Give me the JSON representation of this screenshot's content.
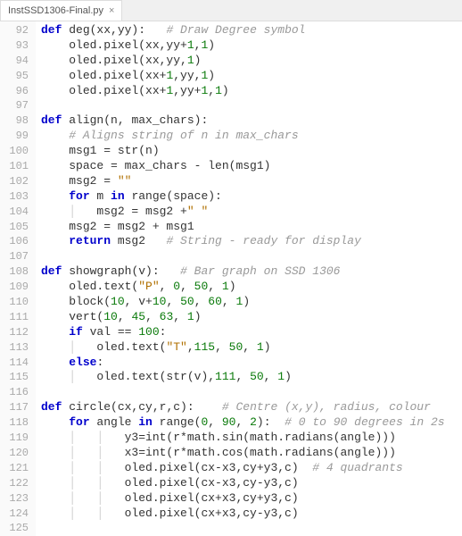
{
  "tab": {
    "filename": "InstSSD1306-Final.py"
  },
  "gutter": {
    "start": 92,
    "end": 125
  },
  "code": {
    "lines": [
      {
        "i": "",
        "t": [
          {
            "k": "kw",
            "s": "def"
          },
          {
            "k": "",
            "s": " "
          },
          {
            "k": "fn",
            "s": "deg"
          },
          {
            "k": "",
            "s": "(xx,yy):   "
          },
          {
            "k": "cmt",
            "s": "# Draw Degree symbol"
          }
        ]
      },
      {
        "i": "    ",
        "t": [
          {
            "k": "",
            "s": "oled.pixel(xx,yy+"
          },
          {
            "k": "num",
            "s": "1"
          },
          {
            "k": "",
            "s": ","
          },
          {
            "k": "num",
            "s": "1"
          },
          {
            "k": "",
            "s": ")"
          }
        ]
      },
      {
        "i": "    ",
        "t": [
          {
            "k": "",
            "s": "oled.pixel(xx,yy,"
          },
          {
            "k": "num",
            "s": "1"
          },
          {
            "k": "",
            "s": ")"
          }
        ]
      },
      {
        "i": "    ",
        "t": [
          {
            "k": "",
            "s": "oled.pixel(xx+"
          },
          {
            "k": "num",
            "s": "1"
          },
          {
            "k": "",
            "s": ",yy,"
          },
          {
            "k": "num",
            "s": "1"
          },
          {
            "k": "",
            "s": ")"
          }
        ]
      },
      {
        "i": "    ",
        "t": [
          {
            "k": "",
            "s": "oled.pixel(xx+"
          },
          {
            "k": "num",
            "s": "1"
          },
          {
            "k": "",
            "s": ",yy+"
          },
          {
            "k": "num",
            "s": "1"
          },
          {
            "k": "",
            "s": ","
          },
          {
            "k": "num",
            "s": "1"
          },
          {
            "k": "",
            "s": ")"
          }
        ]
      },
      {
        "i": "",
        "t": []
      },
      {
        "i": "",
        "t": [
          {
            "k": "kw",
            "s": "def"
          },
          {
            "k": "",
            "s": " "
          },
          {
            "k": "fn",
            "s": "align"
          },
          {
            "k": "",
            "s": "(n, max_chars):"
          }
        ]
      },
      {
        "i": "    ",
        "t": [
          {
            "k": "cmt",
            "s": "# Aligns string of n in max_chars"
          }
        ]
      },
      {
        "i": "    ",
        "t": [
          {
            "k": "",
            "s": "msg1 = str(n)"
          }
        ]
      },
      {
        "i": "    ",
        "t": [
          {
            "k": "",
            "s": "space = max_chars - len(msg1)"
          }
        ]
      },
      {
        "i": "    ",
        "t": [
          {
            "k": "",
            "s": "msg2 = "
          },
          {
            "k": "str",
            "s": "\"\""
          }
        ]
      },
      {
        "i": "    ",
        "t": [
          {
            "k": "kw",
            "s": "for"
          },
          {
            "k": "",
            "s": " m "
          },
          {
            "k": "kw",
            "s": "in"
          },
          {
            "k": "",
            "s": " range(space):"
          }
        ]
      },
      {
        "i": "    |   ",
        "t": [
          {
            "k": "",
            "s": "msg2 = msg2 +"
          },
          {
            "k": "str",
            "s": "\" \""
          }
        ]
      },
      {
        "i": "    ",
        "t": [
          {
            "k": "",
            "s": "msg2 = msg2 + msg1"
          }
        ]
      },
      {
        "i": "    ",
        "t": [
          {
            "k": "kw",
            "s": "return"
          },
          {
            "k": "",
            "s": " msg2   "
          },
          {
            "k": "cmt",
            "s": "# String - ready for display"
          }
        ]
      },
      {
        "i": "",
        "t": []
      },
      {
        "i": "",
        "t": [
          {
            "k": "kw",
            "s": "def"
          },
          {
            "k": "",
            "s": " "
          },
          {
            "k": "fn",
            "s": "showgraph"
          },
          {
            "k": "",
            "s": "(v):   "
          },
          {
            "k": "cmt",
            "s": "# Bar graph on SSD 1306"
          }
        ]
      },
      {
        "i": "    ",
        "t": [
          {
            "k": "",
            "s": "oled.text("
          },
          {
            "k": "str",
            "s": "\"P\""
          },
          {
            "k": "",
            "s": ", "
          },
          {
            "k": "num",
            "s": "0"
          },
          {
            "k": "",
            "s": ", "
          },
          {
            "k": "num",
            "s": "50"
          },
          {
            "k": "",
            "s": ", "
          },
          {
            "k": "num",
            "s": "1"
          },
          {
            "k": "",
            "s": ")"
          }
        ]
      },
      {
        "i": "    ",
        "t": [
          {
            "k": "",
            "s": "block("
          },
          {
            "k": "num",
            "s": "10"
          },
          {
            "k": "",
            "s": ", v+"
          },
          {
            "k": "num",
            "s": "10"
          },
          {
            "k": "",
            "s": ", "
          },
          {
            "k": "num",
            "s": "50"
          },
          {
            "k": "",
            "s": ", "
          },
          {
            "k": "num",
            "s": "60"
          },
          {
            "k": "",
            "s": ", "
          },
          {
            "k": "num",
            "s": "1"
          },
          {
            "k": "",
            "s": ")"
          }
        ]
      },
      {
        "i": "    ",
        "t": [
          {
            "k": "",
            "s": "vert("
          },
          {
            "k": "num",
            "s": "10"
          },
          {
            "k": "",
            "s": ", "
          },
          {
            "k": "num",
            "s": "45"
          },
          {
            "k": "",
            "s": ", "
          },
          {
            "k": "num",
            "s": "63"
          },
          {
            "k": "",
            "s": ", "
          },
          {
            "k": "num",
            "s": "1"
          },
          {
            "k": "",
            "s": ")"
          }
        ]
      },
      {
        "i": "    ",
        "t": [
          {
            "k": "kw",
            "s": "if"
          },
          {
            "k": "",
            "s": " val == "
          },
          {
            "k": "num",
            "s": "100"
          },
          {
            "k": "",
            "s": ":"
          }
        ]
      },
      {
        "i": "    |   ",
        "t": [
          {
            "k": "",
            "s": "oled.text("
          },
          {
            "k": "str",
            "s": "\"T\""
          },
          {
            "k": "",
            "s": ","
          },
          {
            "k": "num",
            "s": "115"
          },
          {
            "k": "",
            "s": ", "
          },
          {
            "k": "num",
            "s": "50"
          },
          {
            "k": "",
            "s": ", "
          },
          {
            "k": "num",
            "s": "1"
          },
          {
            "k": "",
            "s": ")"
          }
        ]
      },
      {
        "i": "    ",
        "t": [
          {
            "k": "kw",
            "s": "else"
          },
          {
            "k": "",
            "s": ":"
          }
        ]
      },
      {
        "i": "    |   ",
        "t": [
          {
            "k": "",
            "s": "oled.text(str(v),"
          },
          {
            "k": "num",
            "s": "111"
          },
          {
            "k": "",
            "s": ", "
          },
          {
            "k": "num",
            "s": "50"
          },
          {
            "k": "",
            "s": ", "
          },
          {
            "k": "num",
            "s": "1"
          },
          {
            "k": "",
            "s": ")"
          }
        ]
      },
      {
        "i": "",
        "t": []
      },
      {
        "i": "",
        "t": [
          {
            "k": "kw",
            "s": "def"
          },
          {
            "k": "",
            "s": " "
          },
          {
            "k": "fn",
            "s": "circle"
          },
          {
            "k": "",
            "s": "(cx,cy,r,c):    "
          },
          {
            "k": "cmt",
            "s": "# Centre (x,y), radius, colour"
          }
        ]
      },
      {
        "i": "    ",
        "t": [
          {
            "k": "kw",
            "s": "for"
          },
          {
            "k": "",
            "s": " angle "
          },
          {
            "k": "kw",
            "s": "in"
          },
          {
            "k": "",
            "s": " range("
          },
          {
            "k": "num",
            "s": "0"
          },
          {
            "k": "",
            "s": ", "
          },
          {
            "k": "num",
            "s": "90"
          },
          {
            "k": "",
            "s": ", "
          },
          {
            "k": "num",
            "s": "2"
          },
          {
            "k": "",
            "s": "):  "
          },
          {
            "k": "cmt",
            "s": "# 0 to 90 degrees in 2s"
          }
        ]
      },
      {
        "i": "    |   |   ",
        "t": [
          {
            "k": "",
            "s": "y3=int(r*math.sin(math.radians(angle)))"
          }
        ]
      },
      {
        "i": "    |   |   ",
        "t": [
          {
            "k": "",
            "s": "x3=int(r*math.cos(math.radians(angle)))"
          }
        ]
      },
      {
        "i": "    |   |   ",
        "t": [
          {
            "k": "",
            "s": "oled.pixel(cx-x3,cy+y3,c)  "
          },
          {
            "k": "cmt",
            "s": "# 4 quadrants"
          }
        ]
      },
      {
        "i": "    |   |   ",
        "t": [
          {
            "k": "",
            "s": "oled.pixel(cx-x3,cy-y3,c)"
          }
        ]
      },
      {
        "i": "    |   |   ",
        "t": [
          {
            "k": "",
            "s": "oled.pixel(cx+x3,cy+y3,c)"
          }
        ]
      },
      {
        "i": "    |   |   ",
        "t": [
          {
            "k": "",
            "s": "oled.pixel(cx+x3,cy-y3,c)"
          }
        ]
      },
      {
        "i": "",
        "t": []
      }
    ]
  }
}
